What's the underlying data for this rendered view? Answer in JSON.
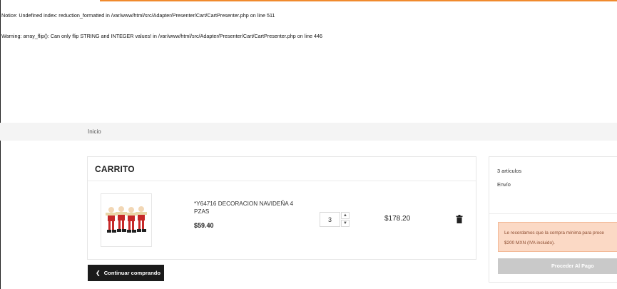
{
  "php_notice": {
    "label": "Notice",
    "text": ": Undefined index: reduction_formatted in ",
    "path": "/var/www/html/src/Adapter/Presenter/Cart/CartPresenter.php",
    "on_line": " on line ",
    "line": "511"
  },
  "php_warning": {
    "label": "Warning",
    "text": ": array_flip(): Can only flip STRING and INTEGER values! in ",
    "path": "/var/www/html/src/Adapter/Presenter/Cart/CartPresenter.php",
    "on_line": " on line ",
    "line": "446"
  },
  "breadcrumb": {
    "home": "Inicio"
  },
  "cart": {
    "title": "CARRITO",
    "item": {
      "name": "*Y64716 DECORACION NAVIDEÑA 4 PZAS",
      "unit_price": "$59.40",
      "quantity": "3",
      "total": "$178.20",
      "thumb_icon": "product-thumbnail"
    },
    "qty_up_icon": "chevron-up-icon",
    "qty_down_icon": "chevron-down-icon",
    "delete_icon": "trash-icon",
    "continue_label": "Continuar comprando",
    "continue_icon": "chevron-left-icon"
  },
  "summary": {
    "items_count": "3 artículos",
    "shipping_label": "Envío",
    "alert_line1": "Le recordamos que la compra mínima para proce",
    "alert_line2": "$200 MXN (IVA incluido).",
    "checkout_label": "Proceder Al Pago"
  },
  "colors": {
    "accent": "#f08a2d",
    "dark_button": "#1b1b1b",
    "alert_bg": "#fbd9c5",
    "disabled_button": "#c9c9c9"
  }
}
